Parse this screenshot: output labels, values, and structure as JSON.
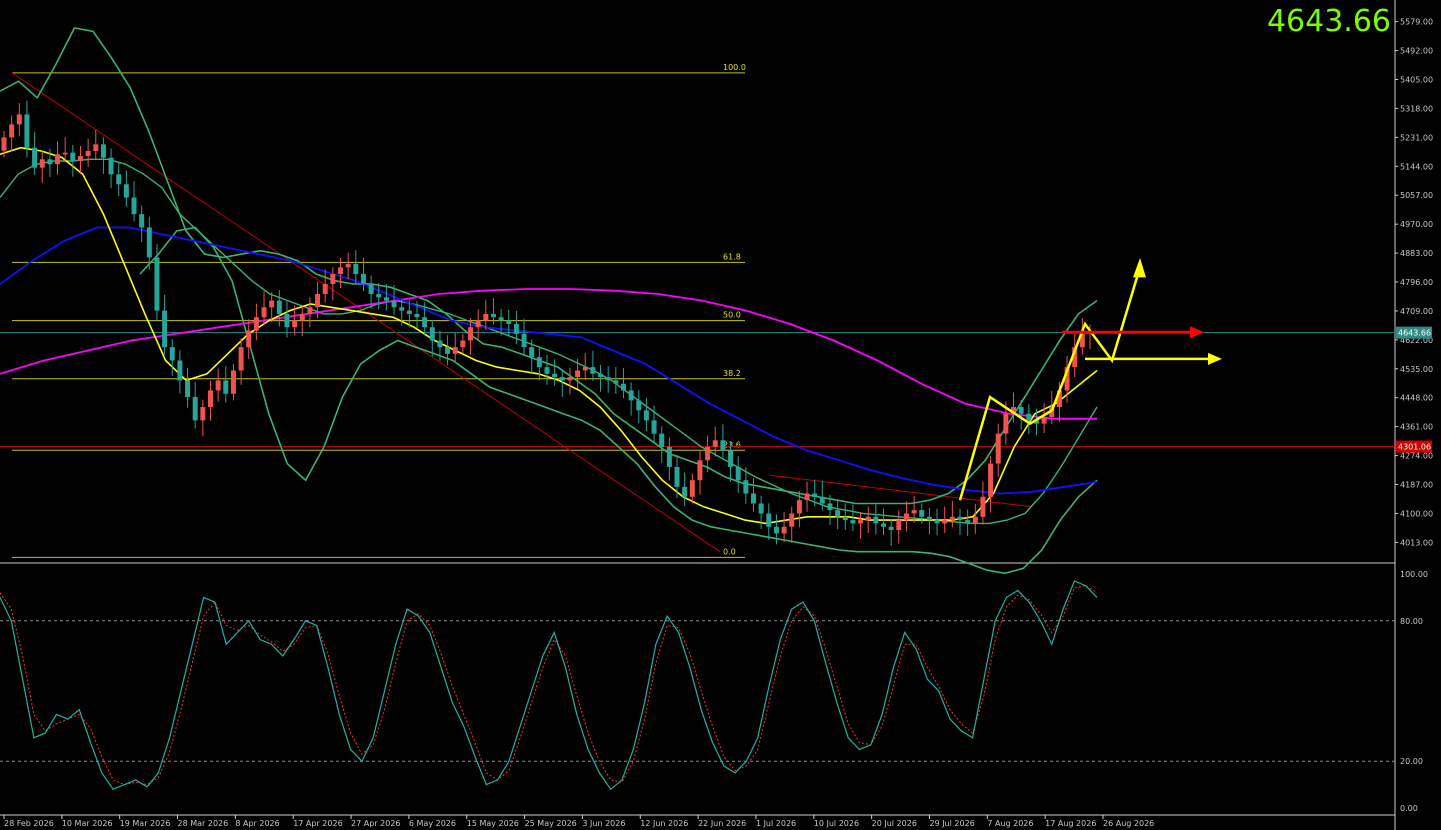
{
  "current_price_display": "4643.66",
  "price_tag_current": "4643.66",
  "price_tag_level": "4301.06",
  "colors": {
    "background": "#000000",
    "bull": "#ef5350",
    "bear": "#26a69a",
    "bollinger": "#3cb371",
    "ma_fast": "#ffff00",
    "ma_slow": "#ff00ff",
    "ma_mid": "#1010ff",
    "fib": "#c8c800",
    "resistance": "#ff0000",
    "stoch_main": "#20b2aa",
    "stoch_signal": "#ff3030",
    "big_price": "#7cfc00"
  },
  "chart_data": [
    {
      "type": "candlestick",
      "y_ticks": [
        "5579.00",
        "5492.00",
        "5405.00",
        "5318.00",
        "5231.00",
        "5144.00",
        "5057.00",
        "4970.00",
        "4883.00",
        "4796.00",
        "4709.00",
        "4622.00",
        "4535.00",
        "4448.00",
        "4361.00",
        "4274.00",
        "4187.00",
        "4100.00",
        "4013.00"
      ],
      "ylim": [
        3960,
        5620
      ],
      "x_ticks": [
        "28 Feb 2026",
        "10 Mar 2026",
        "19 Mar 2026",
        "28 Mar 2026",
        "8 Apr 2026",
        "17 Apr 2026",
        "27 Apr 2026",
        "6 May 2026",
        "15 May 2026",
        "25 May 2026",
        "3 Jun 2026",
        "12 Jun 2026",
        "22 Jun 2026",
        "1 Jul 2026",
        "10 Jul 2026",
        "20 Jul 2026",
        "29 Jul 2026",
        "7 Aug 2026",
        "17 Aug 2026",
        "26 Aug 2026"
      ],
      "fib_levels": [
        {
          "label": "100.0",
          "value": 5425
        },
        {
          "label": "61.8",
          "value": 4855
        },
        {
          "label": "50.0",
          "value": 4680
        },
        {
          "label": "38.2",
          "value": 4505
        },
        {
          "label": "23.6",
          "value": 4290
        },
        {
          "label": "0.0",
          "value": 3968
        }
      ],
      "horizontal_levels": [
        4643.66,
        4301.06
      ],
      "closes": [
        5231,
        5270,
        5300,
        5200,
        5140,
        5165,
        5150,
        5180,
        5185,
        5160,
        5175,
        5190,
        5210,
        5170,
        5120,
        5090,
        5050,
        5000,
        4960,
        4870,
        4710,
        4600,
        4560,
        4500,
        4450,
        4380,
        4420,
        4470,
        4500,
        4460,
        4530,
        4600,
        4650,
        4690,
        4720,
        4740,
        4700,
        4660,
        4680,
        4700,
        4720,
        4760,
        4790,
        4820,
        4840,
        4850,
        4820,
        4790,
        4760,
        4750,
        4740,
        4720,
        4710,
        4700,
        4690,
        4660,
        4620,
        4600,
        4580,
        4600,
        4620,
        4660,
        4680,
        4700,
        4690,
        4680,
        4670,
        4640,
        4600,
        4570,
        4540,
        4520,
        4510,
        4500,
        4510,
        4530,
        4540,
        4520,
        4510,
        4500,
        4490,
        4470,
        4440,
        4410,
        4380,
        4340,
        4300,
        4240,
        4180,
        4150,
        4200,
        4260,
        4300,
        4320,
        4290,
        4240,
        4200,
        4160,
        4130,
        4100,
        4060,
        4040,
        4060,
        4100,
        4140,
        4160,
        4150,
        4130,
        4110,
        4090,
        4080,
        4070,
        4080,
        4090,
        4070,
        4060,
        4050,
        4080,
        4100,
        4110,
        4090,
        4080,
        4070,
        4080,
        4090,
        4080,
        4070,
        4090,
        4150,
        4250,
        4340,
        4400,
        4420,
        4400,
        4380,
        4370,
        4390,
        4420,
        4470,
        4540,
        4600,
        4640,
        4643.66
      ],
      "bollinger_mid": [
        5050,
        5120,
        5150,
        5160,
        5160,
        5165,
        5165,
        5150,
        5120,
        5080,
        5000,
        4950,
        4900,
        4850,
        4800,
        4760,
        4740,
        4720,
        4700,
        4700,
        4710,
        4730,
        4740,
        4730,
        4715,
        4700,
        4680,
        4660,
        4640,
        4620,
        4600,
        4580,
        4555,
        4530,
        4500,
        4460,
        4420,
        4380,
        4340,
        4300,
        4270,
        4240,
        4210,
        4185,
        4160,
        4140,
        4120,
        4110,
        4100,
        4095,
        4090,
        4085,
        4080,
        4075,
        4070,
        4070,
        4080,
        4100,
        4160,
        4240,
        4330,
        4420
      ],
      "bollinger_upper": [
        5370,
        5400,
        5350,
        5450,
        5560,
        5550,
        5470,
        5380,
        5250,
        5100,
        4950,
        4880,
        4870,
        4880,
        4890,
        4880,
        4860,
        4820,
        4800,
        4790,
        4790,
        4780,
        4760,
        4740,
        4700,
        4650,
        4610,
        4600,
        4580,
        4560,
        4540,
        4500,
        4460,
        4400,
        4360,
        4320,
        4280,
        4260,
        4240,
        4210,
        4190,
        4180,
        4170,
        4160,
        4150,
        4140,
        4130,
        4130,
        4130,
        4130,
        4140,
        4160,
        4200,
        4260,
        4350,
        4440,
        4530,
        4620,
        4700,
        4740
      ],
      "bollinger_lower": [
        4820,
        4880,
        4950,
        4960,
        4900,
        4800,
        4600,
        4400,
        4250,
        4200,
        4300,
        4450,
        4550,
        4590,
        4620,
        4600,
        4580,
        4560,
        4520,
        4480,
        4460,
        4440,
        4420,
        4400,
        4380,
        4350,
        4300,
        4250,
        4180,
        4120,
        4080,
        4060,
        4050,
        4040,
        4030,
        4020,
        4010,
        4000,
        3990,
        3985,
        3985,
        3985,
        3985,
        3980,
        3970,
        3950,
        3930,
        3920,
        3935,
        3990,
        4080,
        4150,
        4200
      ],
      "ma_fast_values": [
        5180,
        5200,
        5190,
        5170,
        5120,
        5000,
        4850,
        4700,
        4560,
        4500,
        4520,
        4580,
        4640,
        4680,
        4710,
        4730,
        4720,
        4710,
        4700,
        4690,
        4660,
        4620,
        4590,
        4560,
        4540,
        4530,
        4520,
        4500,
        4470,
        4420,
        4350,
        4270,
        4200,
        4150,
        4120,
        4100,
        4080,
        4070,
        4080,
        4090,
        4090,
        4090,
        4080,
        4080,
        4080,
        4080,
        4080,
        4090,
        4160,
        4300,
        4400,
        4430,
        4480,
        4530
      ],
      "ma_mid_values": [
        4790,
        4860,
        4920,
        4960,
        4960,
        4940,
        4920,
        4900,
        4880,
        4860,
        4830,
        4800,
        4760,
        4720,
        4680,
        4660,
        4650,
        4640,
        4630,
        4590,
        4550,
        4490,
        4430,
        4380,
        4330,
        4290,
        4260,
        4230,
        4205,
        4185,
        4170,
        4160,
        4165,
        4180,
        4195
      ],
      "ma_slow_values": [
        4520,
        4560,
        4590,
        4620,
        4640,
        4660,
        4680,
        4700,
        4720,
        4740,
        4760,
        4770,
        4775,
        4775,
        4770,
        4760,
        4740,
        4710,
        4670,
        4620,
        4560,
        4490,
        4430,
        4400,
        4385,
        4385
      ],
      "stochastic": {
        "levels": [
          100,
          80,
          20,
          0
        ],
        "tick_labels": [
          "100.00",
          "80.00",
          "20.00",
          "0.00"
        ],
        "main": [
          90,
          80,
          55,
          30,
          32,
          40,
          38,
          42,
          28,
          15,
          8,
          10,
          12,
          9,
          15,
          30,
          50,
          70,
          90,
          88,
          70,
          75,
          80,
          72,
          70,
          65,
          72,
          80,
          78,
          60,
          40,
          25,
          20,
          30,
          50,
          70,
          85,
          82,
          75,
          60,
          45,
          35,
          22,
          10,
          12,
          20,
          35,
          50,
          65,
          75,
          60,
          40,
          25,
          15,
          8,
          12,
          25,
          45,
          70,
          82,
          75,
          60,
          42,
          28,
          18,
          15,
          20,
          30,
          52,
          72,
          85,
          88,
          80,
          62,
          45,
          30,
          25,
          27,
          40,
          60,
          75,
          68,
          55,
          50,
          38,
          33,
          30,
          55,
          80,
          90,
          93,
          88,
          80,
          70,
          85,
          97,
          95,
          90
        ],
        "signal": [
          92,
          85,
          65,
          40,
          33,
          36,
          38,
          40,
          34,
          22,
          12,
          10,
          11,
          10,
          13,
          24,
          42,
          62,
          82,
          88,
          78,
          76,
          78,
          74,
          71,
          67,
          70,
          77,
          78,
          66,
          48,
          32,
          23,
          27,
          42,
          62,
          80,
          83,
          78,
          66,
          52,
          40,
          28,
          15,
          12,
          16,
          30,
          45,
          60,
          72,
          65,
          48,
          32,
          20,
          12,
          11,
          20,
          38,
          62,
          78,
          77,
          66,
          50,
          35,
          22,
          16,
          18,
          25,
          45,
          65,
          80,
          86,
          82,
          68,
          52,
          36,
          28,
          27,
          35,
          52,
          70,
          70,
          60,
          52,
          42,
          36,
          32,
          48,
          72,
          86,
          91,
          89,
          83,
          75,
          82,
          94,
          95,
          92
        ]
      }
    }
  ]
}
